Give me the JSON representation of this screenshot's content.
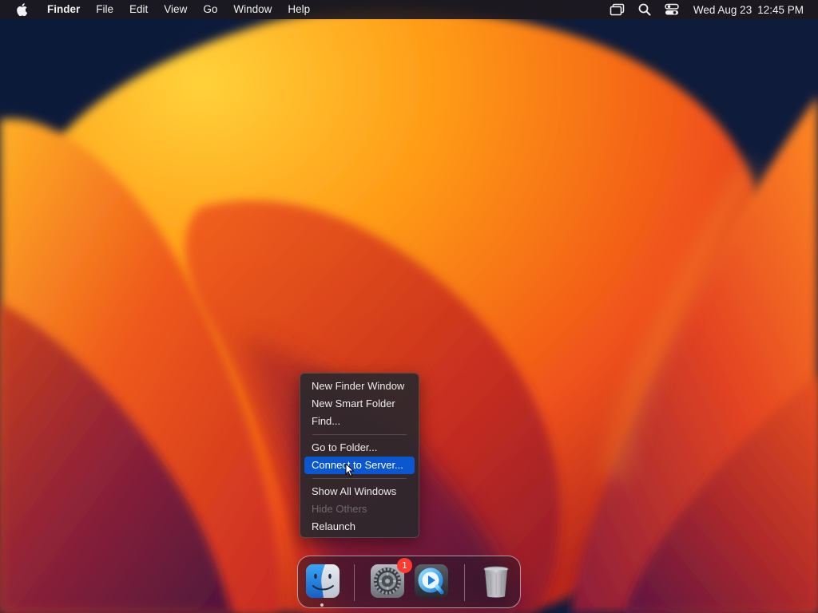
{
  "menubar": {
    "apple_icon": "apple-logo-icon",
    "app_name": "Finder",
    "menus": [
      "File",
      "Edit",
      "View",
      "Go",
      "Window",
      "Help"
    ],
    "status_icons": [
      "screen-mirroring-icon",
      "spotlight-search-icon",
      "control-center-icon"
    ],
    "clock": {
      "date": "Wed Aug 23",
      "time": "12:45 PM"
    }
  },
  "context_menu": {
    "groups": [
      [
        {
          "label": "New Finder Window",
          "state": "normal"
        },
        {
          "label": "New Smart Folder",
          "state": "normal"
        },
        {
          "label": "Find...",
          "state": "normal"
        }
      ],
      [
        {
          "label": "Go to Folder...",
          "state": "normal"
        },
        {
          "label": "Connect to Server...",
          "state": "highlighted"
        }
      ],
      [
        {
          "label": "Show All Windows",
          "state": "normal"
        },
        {
          "label": "Hide Others",
          "state": "disabled"
        },
        {
          "label": "Relaunch",
          "state": "normal"
        }
      ]
    ],
    "highlight_color": "#0b57d0"
  },
  "dock": {
    "apps": [
      {
        "name": "finder-icon",
        "running": true
      },
      {
        "name": "system-settings-icon",
        "badge": "1"
      },
      {
        "name": "quicktime-player-icon"
      },
      {
        "name": "trash-icon"
      }
    ],
    "badge_color": "#ff3b30"
  },
  "wallpaper": {
    "theme": "macos-ventura-orange",
    "colors": [
      "#0d1a38",
      "#ff9a1a",
      "#e0401a",
      "#6a1848"
    ]
  }
}
